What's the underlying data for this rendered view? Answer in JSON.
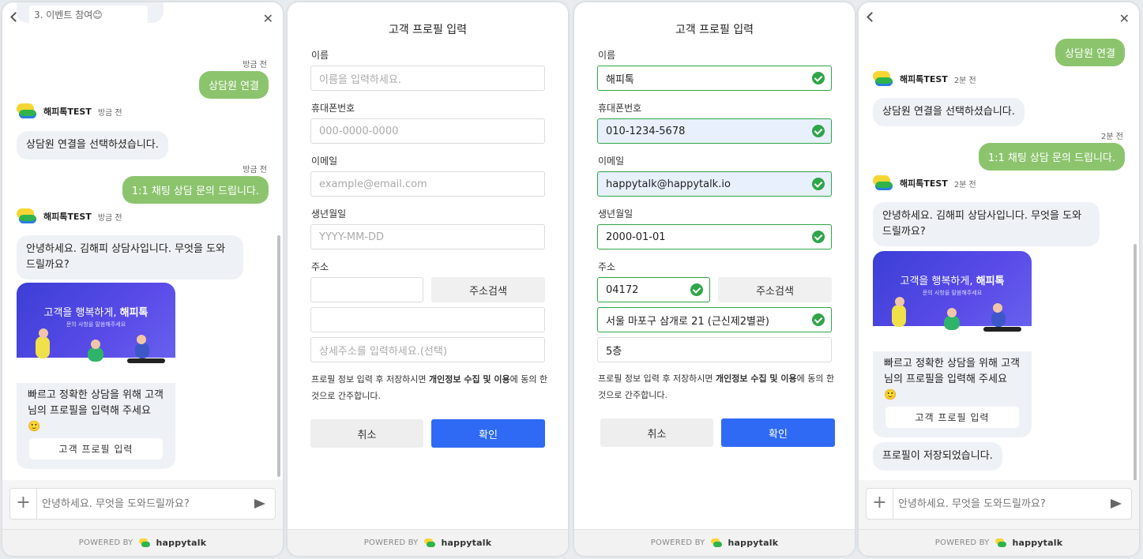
{
  "common": {
    "powered_by": "POWERED BY",
    "brand": "happytalk"
  },
  "chat_left": {
    "partial_top_text": "3. 이벤트 참여😊",
    "time_just_now": "방금 전",
    "out_connect": "상담원 연결",
    "bot_name": "해피톡TEST",
    "in_connect_selected": "상담원 연결을 선택하셨습니다.",
    "out_inquiry": "1:1 채팅 상담 문의 드립니다.",
    "in_greeting": "안녕하세요. 김해피 상담사입니다. 무엇을 도와드릴까요?",
    "banner_title_pre": "고객을 행복하게,",
    "banner_title_brand": "해피톡",
    "banner_sub": "문의 사항을 말씀해주세요",
    "card_text": "빠르고 정확한 상담을 위해 고객님의 프로필을 입력해 주세요 🙂",
    "card_button": "고객 프로필 입력",
    "input_placeholder": "안녕하세요. 무엇을 도와드릴까요?"
  },
  "form_empty": {
    "title": "고객 프로필 입력",
    "name_label": "이름",
    "name_placeholder": "이름을 입력하세요.",
    "phone_label": "휴대폰번호",
    "phone_placeholder": "000-0000-0000",
    "email_label": "이메일",
    "email_placeholder": "example@email.com",
    "birth_label": "생년월일",
    "birth_placeholder": "YYYY-MM-DD",
    "address_label": "주소",
    "address_search": "주소검색",
    "detail_placeholder": "상세주소를 입력하세요.(선택)",
    "notice_pre": "프로필 정보 입력 후 저장하시면 ",
    "notice_bold": "개인정보 수집 및 이용",
    "notice_post": "에 동의 한 것으로 간주합니다.",
    "cancel": "취소",
    "confirm": "확인"
  },
  "form_filled": {
    "title": "고객 프로필 입력",
    "name_label": "이름",
    "name_value": "해피톡",
    "phone_label": "휴대폰번호",
    "phone_value": "010-1234-5678",
    "email_label": "이메일",
    "email_value": "happytalk@happytalk.io",
    "birth_label": "생년월일",
    "birth_value": "2000-01-01",
    "address_label": "주소",
    "zip_value": "04172",
    "address_search": "주소검색",
    "address_value": "서울 마포구 삼개로 21 (근신제2별관)",
    "detail_value": "5층",
    "notice_pre": "프로필 정보 입력 후 저장하시면 ",
    "notice_bold": "개인정보 수집 및 이용",
    "notice_post": "에 동의 한 것으로 간주합니다.",
    "cancel": "취소",
    "confirm": "확인"
  },
  "chat_right": {
    "out_connect": "상담원 연결",
    "bot_name": "해피톡TEST",
    "time_2min": "2분 전",
    "in_connect_selected": "상담원 연결을 선택하셨습니다.",
    "out_inquiry": "1:1 채팅 상담 문의 드립니다.",
    "in_greeting": "안녕하세요. 김해피 상담사입니다. 무엇을 도와드릴까요?",
    "banner_title_pre": "고객을 행복하게,",
    "banner_title_brand": "해피톡",
    "banner_sub": "문의 사항을 말씀해주세요",
    "card_text": "빠르고 정확한 상담을 위해 고객님의 프로필을 입력해 주세요 🙂",
    "card_button": "고객 프로필 입력",
    "in_saved": "프로필이 저장되었습니다.",
    "input_placeholder": "안녕하세요. 무엇을 도와드릴까요?"
  }
}
